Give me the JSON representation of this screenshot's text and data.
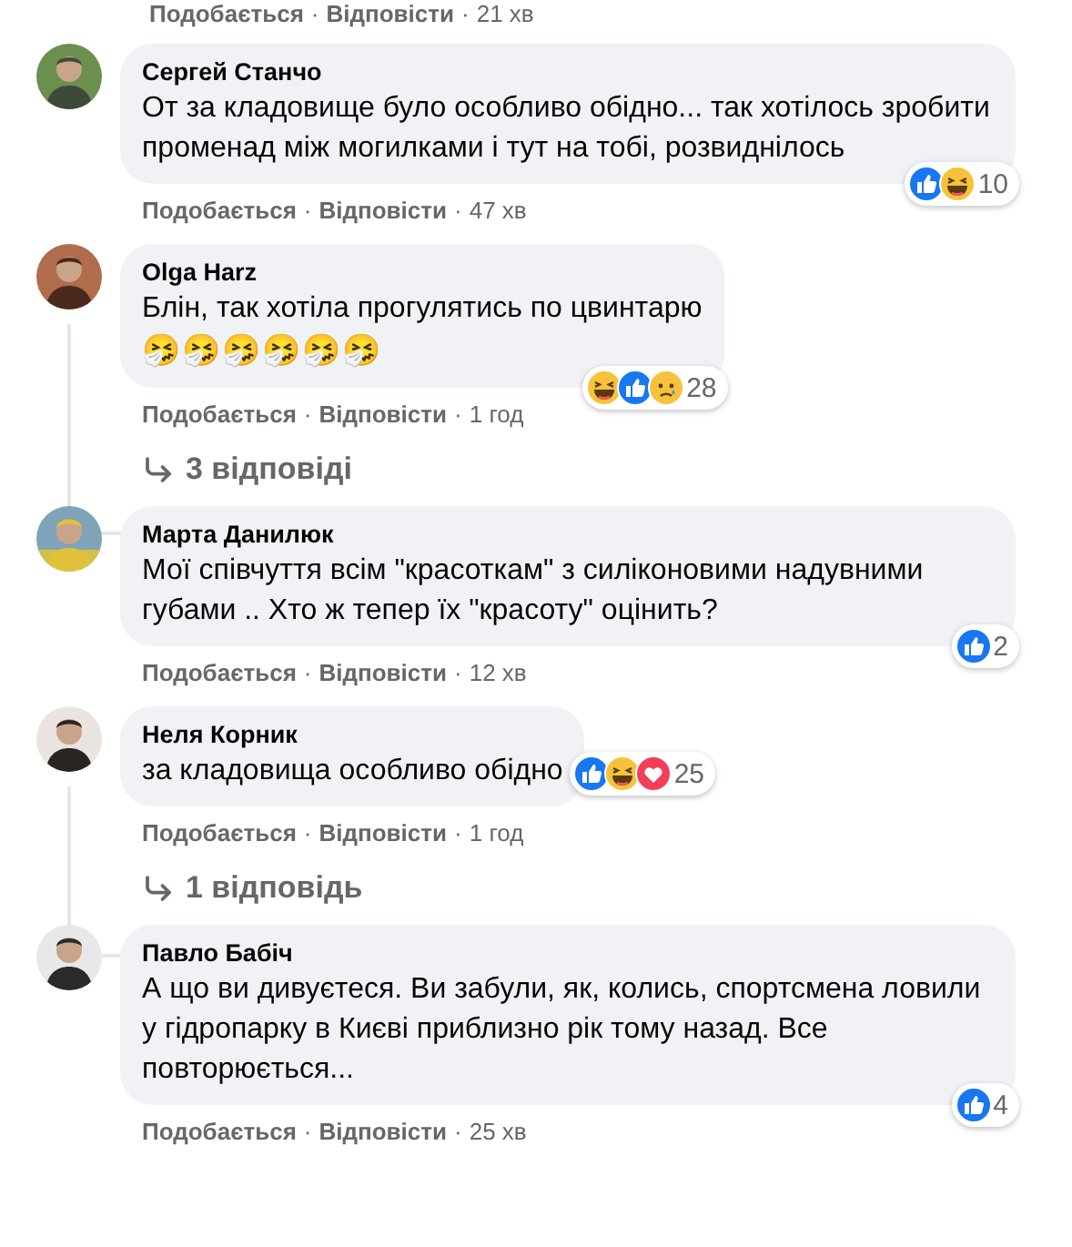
{
  "top_actions": {
    "like": "Подобається",
    "separator": "·",
    "reply": "Відповісти",
    "time": "21 хв"
  },
  "comments": [
    {
      "author": "Сергей Станчо",
      "text": "От за кладовище було особливо обідно... так хотілось зробити променад між могилками і тут на тобі, розвиднілось",
      "kind": "corner",
      "separator": "·",
      "reactions": [
        {
          "kind": "like"
        },
        {
          "kind": "haha"
        }
      ],
      "reaction_count": "10",
      "like": "Подобається",
      "reply": "Відповісти",
      "time": "47 хв"
    },
    {
      "author": "Olga Harz",
      "text": "Блін, так хотіла прогулятись по цвинтарю",
      "emoji": "🤧🤧🤧🤧🤧🤧",
      "kind": "corner",
      "separator": "·",
      "reactions": [
        {
          "kind": "haha"
        },
        {
          "kind": "like"
        },
        {
          "kind": "sad"
        }
      ],
      "reaction_count": "28",
      "like": "Подобається",
      "reply": "Відповісти",
      "time": "1 год",
      "replies": "3 відповіді"
    },
    {
      "author": "Марта Данилюк",
      "text": "Мої співчуття всім \"красоткам\" з силіконовими надувними губами .. Хто ж тепер їх \"красоту\" оцінить?",
      "kind": "corner",
      "separator": "·",
      "reactions": [
        {
          "kind": "like"
        }
      ],
      "reaction_count": "2",
      "like": "Подобається",
      "reply": "Відповісти",
      "time": "12 хв"
    },
    {
      "author": "Неля Корник",
      "text": "за кладовища особливо обідно",
      "kind": "side",
      "separator": "·",
      "reactions": [
        {
          "kind": "like"
        },
        {
          "kind": "haha"
        },
        {
          "kind": "love"
        }
      ],
      "reaction_count": "25",
      "like": "Подобається",
      "reply": "Відповісти",
      "time": "1 год",
      "replies": "1 відповідь"
    },
    {
      "author": "Павло Бабіч",
      "text": "А що ви дивуєтеся. Ви забули, як, колись, спортсмена ловили у гідропарку в Києві приблизно рік тому назад. Все повторюється...",
      "kind": "corner",
      "separator": "·",
      "reactions": [
        {
          "kind": "like"
        }
      ],
      "reaction_count": "4",
      "like": "Подобається",
      "reply": "Відповісти",
      "time": "25 хв"
    }
  ]
}
